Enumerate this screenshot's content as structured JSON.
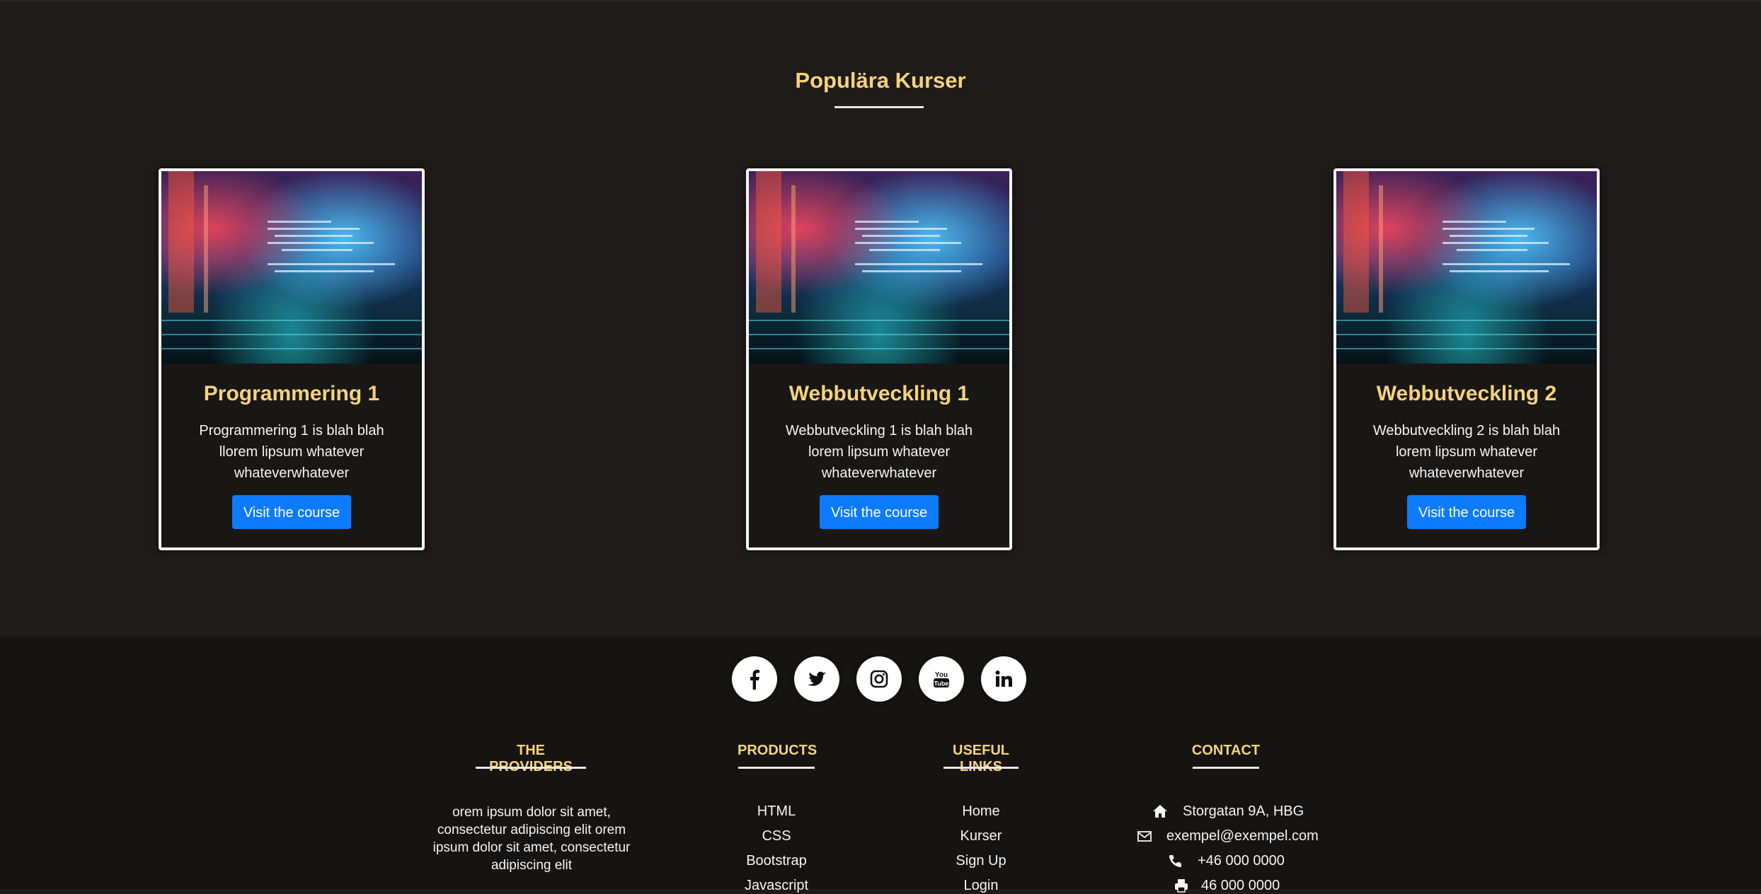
{
  "section": {
    "heading": "Populära Kurser"
  },
  "courses": [
    {
      "title": "Programmering 1",
      "text_lines": [
        "Programmering 1 is blah blah",
        "llorem lipsum whatever",
        "whateverwhatever"
      ],
      "button": "Visit the course"
    },
    {
      "title": "Webbutveckling 1",
      "text_lines": [
        "Webbutveckling 1 is blah blah",
        "lorem lipsum whatever",
        "whateverwhatever"
      ],
      "button": "Visit the course"
    },
    {
      "title": "Webbutveckling 2",
      "text_lines": [
        "Webbutveckling 2 is blah blah",
        "lorem lipsum whatever",
        "whateverwhatever"
      ],
      "button": "Visit the course"
    }
  ],
  "social": [
    "facebook-icon",
    "twitter-icon",
    "instagram-icon",
    "youtube-icon",
    "linkedin-icon"
  ],
  "footer": {
    "providers": {
      "title": "THE PROVIDERS",
      "lines": [
        "orem ipsum dolor sit amet,",
        "consectetur adipiscing elit orem",
        "ipsum dolor sit amet, consectetur",
        "adipiscing elit"
      ]
    },
    "products": {
      "title": "PRODUCTS",
      "items": [
        "HTML",
        "CSS",
        "Bootstrap",
        "Javascript"
      ]
    },
    "useful_links": {
      "title": "USEFUL LINKS",
      "items": [
        "Home",
        "Kurser",
        "Sign Up",
        "Login"
      ]
    },
    "contact": {
      "title": "CONTACT",
      "address": "Storgatan 9A, HBG",
      "email": "exempel@exempel.com",
      "phone": "+46 000 0000",
      "fax": "46 000 0000"
    }
  },
  "colors": {
    "background": "#1f1b1a",
    "footer_background": "#161413",
    "accent": "#f5d27c",
    "button": "#0d7bfb"
  }
}
